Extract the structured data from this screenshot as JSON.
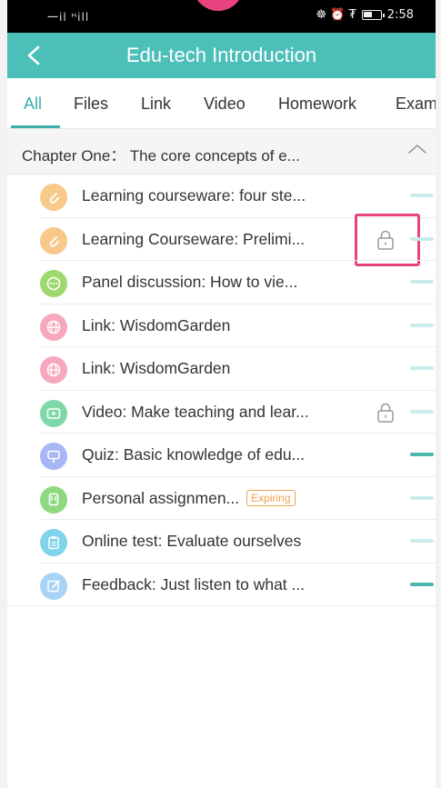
{
  "status_bar": {
    "signal_text": "㆒il ᴴill",
    "wifi_icon": "wifi-icon",
    "icons_text": "☸ ⏰ ₮",
    "time": "2:58"
  },
  "header": {
    "title": "Edu-tech Introduction",
    "back_icon": "back-chevron-icon",
    "color": "#4cbfb8"
  },
  "tabs": [
    {
      "label": "All",
      "active": true
    },
    {
      "label": "Files",
      "active": false
    },
    {
      "label": "Link",
      "active": false
    },
    {
      "label": "Video",
      "active": false
    },
    {
      "label": "Homework",
      "active": false
    },
    {
      "label": "Exam",
      "active": false
    }
  ],
  "chapter": {
    "title": "Chapter One： The core concepts of e...",
    "toggle_icon": "chevron-up-icon"
  },
  "items": [
    {
      "label": "Learning courseware: four ste...",
      "icon": "paperclip-icon",
      "icon_color": "#f7c98a",
      "locked": false,
      "progress": "light"
    },
    {
      "label": "Learning Courseware: Prelimi...",
      "icon": "paperclip-icon",
      "icon_color": "#f7c98a",
      "locked": true,
      "progress": "light"
    },
    {
      "label": "Panel discussion: How to vie...",
      "icon": "chat-bubble-icon",
      "icon_color": "#9fd86f",
      "locked": false,
      "progress": "light"
    },
    {
      "label": "Link: WisdomGarden",
      "icon": "globe-icon",
      "icon_color": "#f6a9bd",
      "locked": false,
      "progress": "light"
    },
    {
      "label": "Link: WisdomGarden",
      "icon": "globe-icon",
      "icon_color": "#f6a9bd",
      "locked": false,
      "progress": "light"
    },
    {
      "label": "Video: Make teaching and lear...",
      "icon": "play-icon",
      "icon_color": "#7fd8a6",
      "locked": true,
      "progress": "light"
    },
    {
      "label": "Quiz: Basic knowledge of edu...",
      "icon": "quiz-icon",
      "icon_color": "#a8b6f5",
      "locked": false,
      "progress": "dark"
    },
    {
      "label": "Personal assignmen...",
      "icon": "assignment-icon",
      "icon_color": "#8fd87f",
      "locked": false,
      "progress": "light",
      "badge": "Expiring"
    },
    {
      "label": "Online test: Evaluate ourselves",
      "icon": "clipboard-icon",
      "icon_color": "#7fd3ea",
      "locked": false,
      "progress": "light"
    },
    {
      "label": "Feedback: Just listen to what ...",
      "icon": "edit-icon",
      "icon_color": "#a9d3f5",
      "locked": false,
      "progress": "dark"
    }
  ],
  "colors": {
    "accent": "#3bb0a8",
    "highlight": "#e8437e",
    "badge": "#f0a24a"
  }
}
